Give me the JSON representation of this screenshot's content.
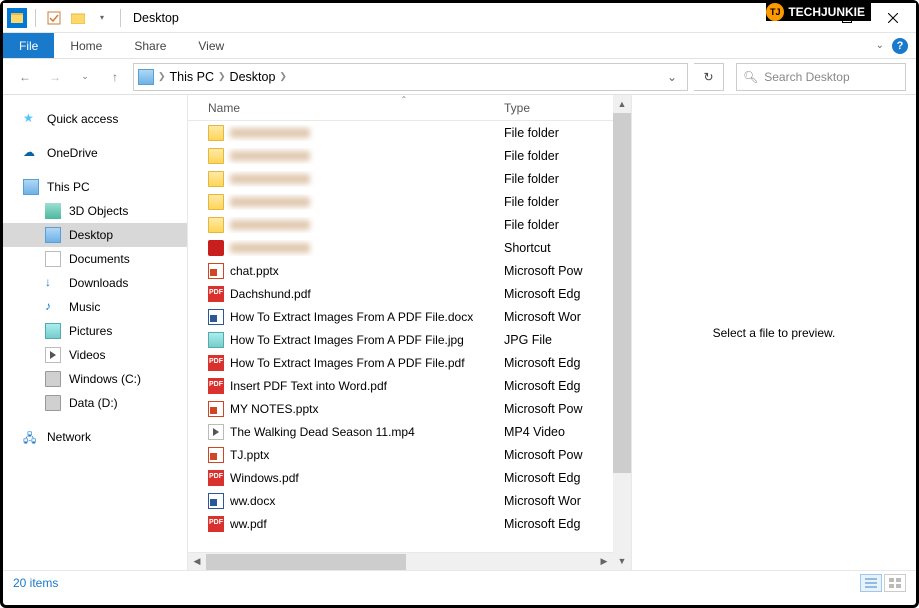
{
  "window": {
    "title": "Desktop"
  },
  "badge": {
    "text": "TECHJUNKIE",
    "logo": "TJ"
  },
  "ribbon": {
    "tabs": {
      "file": "File",
      "home": "Home",
      "share": "Share",
      "view": "View"
    }
  },
  "breadcrumbs": {
    "root": "This PC",
    "current": "Desktop"
  },
  "search": {
    "placeholder": "Search Desktop"
  },
  "nav_pane": {
    "quick_access": "Quick access",
    "onedrive": "OneDrive",
    "this_pc": "This PC",
    "children": {
      "objects3d": "3D Objects",
      "desktop": "Desktop",
      "documents": "Documents",
      "downloads": "Downloads",
      "music": "Music",
      "pictures": "Pictures",
      "videos": "Videos",
      "c": "Windows (C:)",
      "d": "Data (D:)"
    },
    "network": "Network"
  },
  "columns": {
    "name": "Name",
    "type": "Type"
  },
  "files": [
    {
      "name": "",
      "type": "File folder",
      "icon": "folder",
      "blurred": true
    },
    {
      "name": "",
      "type": "File folder",
      "icon": "folder",
      "blurred": true
    },
    {
      "name": "",
      "type": "File folder",
      "icon": "folder",
      "blurred": true
    },
    {
      "name": "",
      "type": "File folder",
      "icon": "folder",
      "blurred": true
    },
    {
      "name": "",
      "type": "File folder",
      "icon": "folder",
      "blurred": true
    },
    {
      "name": "",
      "type": "Shortcut",
      "icon": "red",
      "blurred": true
    },
    {
      "name": "chat.pptx",
      "type": "Microsoft Pow",
      "icon": "ppt"
    },
    {
      "name": "Dachshund.pdf",
      "type": "Microsoft Edg",
      "icon": "pdf"
    },
    {
      "name": "How To Extract Images From A PDF File.docx",
      "type": "Microsoft Wor",
      "icon": "word"
    },
    {
      "name": "How To Extract Images From A PDF File.jpg",
      "type": "JPG File",
      "icon": "img"
    },
    {
      "name": "How To Extract Images From A PDF File.pdf",
      "type": "Microsoft Edg",
      "icon": "pdf"
    },
    {
      "name": "Insert PDF Text into Word.pdf",
      "type": "Microsoft Edg",
      "icon": "pdf"
    },
    {
      "name": "MY NOTES.pptx",
      "type": "Microsoft Pow",
      "icon": "ppt"
    },
    {
      "name": "The Walking Dead Season 11.mp4",
      "type": "MP4 Video",
      "icon": "vid"
    },
    {
      "name": "TJ.pptx",
      "type": "Microsoft Pow",
      "icon": "ppt"
    },
    {
      "name": "Windows.pdf",
      "type": "Microsoft Edg",
      "icon": "pdf"
    },
    {
      "name": "ww.docx",
      "type": "Microsoft Wor",
      "icon": "word"
    },
    {
      "name": "ww.pdf",
      "type": "Microsoft Edg",
      "icon": "pdf"
    }
  ],
  "preview": {
    "empty": "Select a file to preview."
  },
  "status": {
    "count": "20 items"
  }
}
